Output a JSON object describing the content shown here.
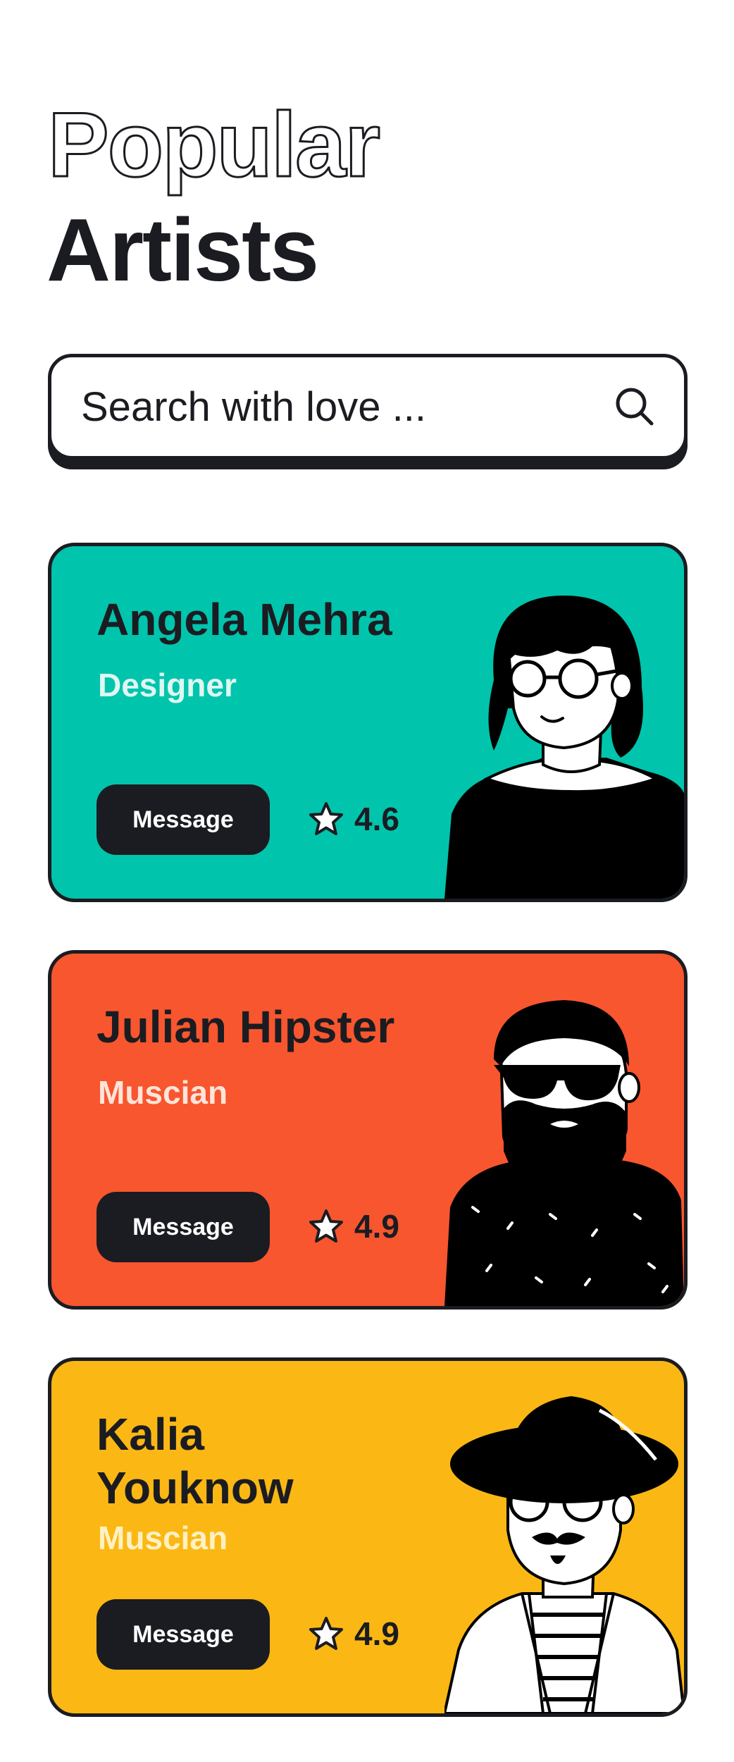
{
  "header": {
    "title_line1": "Popular",
    "title_line2": "Artists"
  },
  "search": {
    "placeholder": "Search with love ...",
    "icon": "search-icon"
  },
  "artists": [
    {
      "name": "Angela Mehra",
      "role": "Designer",
      "rating": "4.6",
      "button_label": "Message",
      "card_color": "#01c4ad",
      "role_color": "#dff7f1",
      "avatar": "woman-with-glasses-avatar"
    },
    {
      "name": "Julian Hipster",
      "role": "Muscian",
      "rating": "4.9",
      "button_label": "Message",
      "card_color": "#f7562f",
      "role_color": "#ffe4d8",
      "avatar": "bearded-man-sunglasses-avatar"
    },
    {
      "name": "Kalia Youknow",
      "role": "Muscian",
      "rating": "4.9",
      "button_label": "Message",
      "card_color": "#fbb814",
      "role_color": "#fff1c4",
      "avatar": "man-with-hat-avatar"
    }
  ],
  "colors": {
    "ink": "#1b1c21",
    "background": "#ffffff"
  }
}
